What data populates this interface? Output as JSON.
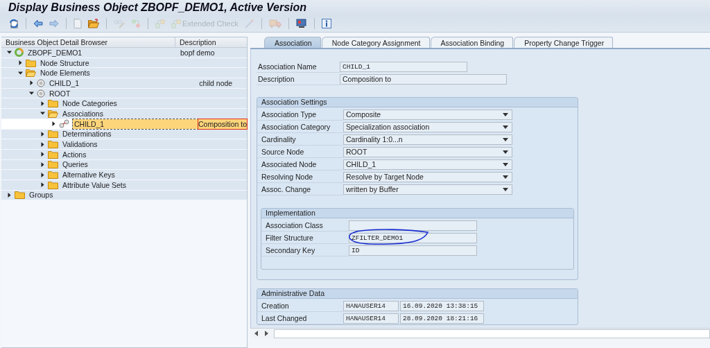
{
  "window": {
    "title": "Display Business Object ZBOPF_DEMO1, Active Version"
  },
  "toolbar": [
    [
      {
        "kind": "refresh",
        "disabled": false
      }
    ],
    [
      {
        "kind": "back",
        "disabled": false
      },
      {
        "kind": "forward",
        "disabled": true
      }
    ],
    [
      {
        "kind": "new",
        "disabled": true
      },
      {
        "kind": "open",
        "disabled": false
      }
    ],
    [
      {
        "kind": "glasses",
        "disabled": true
      },
      {
        "kind": "nodes",
        "disabled": true
      }
    ],
    [
      {
        "kind": "check",
        "disabled": true
      },
      {
        "kind": "check",
        "disabled": true,
        "label": "Extended Check"
      },
      {
        "kind": "wand",
        "disabled": true
      }
    ],
    [
      {
        "kind": "transport",
        "disabled": true
      }
    ],
    [
      {
        "kind": "monitor",
        "disabled": false
      }
    ],
    [
      {
        "kind": "info",
        "disabled": false
      }
    ]
  ],
  "browser": {
    "columns": [
      "Business Object Detail Browser",
      "Description"
    ],
    "tree": [
      {
        "kind": "bo",
        "label": "ZBOPF_DEMO1",
        "description": "bopf demo",
        "expanded": true,
        "selected": false,
        "children": [
          {
            "kind": "folder",
            "label": "Node Structure",
            "expanded": false,
            "selected": false
          },
          {
            "kind": "folder",
            "label": "Node Elements",
            "expanded": true,
            "selected": false,
            "children": [
              {
                "kind": "node",
                "label": "CHILD_1",
                "description": "child node",
                "expanded": false,
                "selected": false
              },
              {
                "kind": "node",
                "label": "ROOT",
                "expanded": true,
                "selected": false,
                "children": [
                  {
                    "kind": "folder",
                    "label": "Node Categories",
                    "expanded": false,
                    "selected": false
                  },
                  {
                    "kind": "folder",
                    "label": "Associations",
                    "expanded": true,
                    "selected": false,
                    "children": [
                      {
                        "kind": "association",
                        "label": "CHILD_1",
                        "description": "Composition to",
                        "expanded": false,
                        "selected": true
                      }
                    ]
                  },
                  {
                    "kind": "folder",
                    "label": "Determinations",
                    "expanded": false,
                    "selected": false
                  },
                  {
                    "kind": "folder",
                    "label": "Validations",
                    "expanded": false,
                    "selected": false
                  },
                  {
                    "kind": "folder",
                    "label": "Actions",
                    "expanded": false,
                    "selected": false
                  },
                  {
                    "kind": "folder",
                    "label": "Queries",
                    "expanded": false,
                    "selected": false
                  },
                  {
                    "kind": "folder",
                    "label": "Alternative Keys",
                    "expanded": false,
                    "selected": false
                  },
                  {
                    "kind": "folder",
                    "label": "Attribute Value Sets",
                    "expanded": false,
                    "selected": false
                  }
                ]
              }
            ]
          }
        ]
      },
      {
        "kind": "folder",
        "label": "Groups",
        "expanded": false,
        "selected": false
      }
    ]
  },
  "tabs": [
    {
      "label": "Association",
      "selected": true
    },
    {
      "label": "Node Category Assignment",
      "selected": false
    },
    {
      "label": "Association Binding",
      "selected": false
    },
    {
      "label": "Property Change Trigger",
      "selected": false
    }
  ],
  "header_fields": [
    {
      "label": "Association Name",
      "value": "CHILD_1",
      "kind": "code"
    },
    {
      "label": "Description",
      "value": "Composition to",
      "kind": "text"
    }
  ],
  "association_settings": {
    "title": "Association Settings",
    "fields": [
      {
        "label": "Association Type",
        "value": "Composite",
        "kind": "dropdown"
      },
      {
        "label": "Association Category",
        "value": "Specialization association",
        "kind": "dropdown"
      },
      {
        "label": "Cardinality",
        "value": "Cardinality 1:0...n",
        "kind": "dropdown"
      },
      {
        "label": "Source Node",
        "value": "ROOT",
        "kind": "dropdown"
      },
      {
        "label": "Associated Node",
        "value": "CHILD_1",
        "kind": "dropdown"
      },
      {
        "label": "Resolving Node",
        "value": "Resolve by Target Node",
        "kind": "dropdown"
      },
      {
        "label": "Assoc. Change",
        "value": "written by Buffer",
        "kind": "dropdown"
      }
    ]
  },
  "implementation": {
    "title": "Implementation",
    "fields": [
      {
        "label": "Association Class",
        "kind": "code"
      },
      {
        "label": "Filter Structure",
        "value": "ZFILTER_DEMO1",
        "kind": "code",
        "circled": true
      },
      {
        "label": "Secondary Key",
        "value": "ID",
        "kind": "code"
      }
    ]
  },
  "administrative_data": {
    "title": "Administrative Data",
    "rows": [
      {
        "label": "Creation",
        "user": "HANAUSER14",
        "timestamp": "16.09.2020 13:38:15"
      },
      {
        "label": "Last Changed",
        "user": "HANAUSER14",
        "timestamp": "28.09.2020 18:21:16"
      }
    ]
  }
}
